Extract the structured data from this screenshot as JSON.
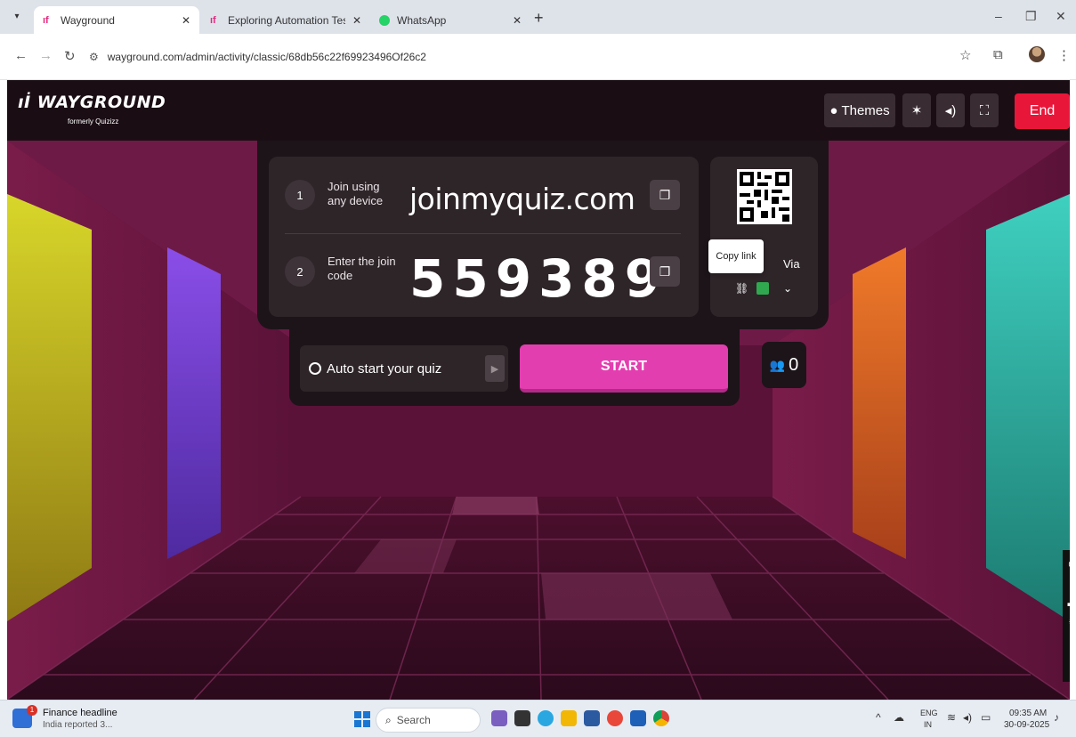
{
  "browser": {
    "tabs": [
      {
        "label": "Wayground",
        "active": true
      },
      {
        "label": "Exploring Automation Testing ",
        "active": false
      },
      {
        "label": "WhatsApp",
        "active": false
      }
    ],
    "url": "wayground.com/admin/activity/classic/68db56c22f69923496Of26c2"
  },
  "header": {
    "logo": "WAYGROUND",
    "logo_sub": "formerly Quizizz",
    "themes_label": "Themes",
    "end_label": "End"
  },
  "join": {
    "step1_num": "1",
    "step1_text": "Join using any device",
    "url": "joinmyquiz.com",
    "step2_num": "2",
    "step2_text": "Enter the join code",
    "code": "559389",
    "share_via": "Via",
    "tooltip": "Copy link"
  },
  "controls": {
    "auto_start": "Auto start your quiz",
    "start": "START",
    "players": "0"
  },
  "taskbar": {
    "news_title": "Finance headline",
    "news_sub": "India reported 3...",
    "news_badge": "1",
    "search": "Search",
    "lang_top": "ENG",
    "lang_bottom": "IN",
    "time": "09:35 AM",
    "date": "30-09-2025"
  },
  "colors": {
    "end": "#e8173a",
    "start": "#e33eb0",
    "card": "#1c1419"
  }
}
